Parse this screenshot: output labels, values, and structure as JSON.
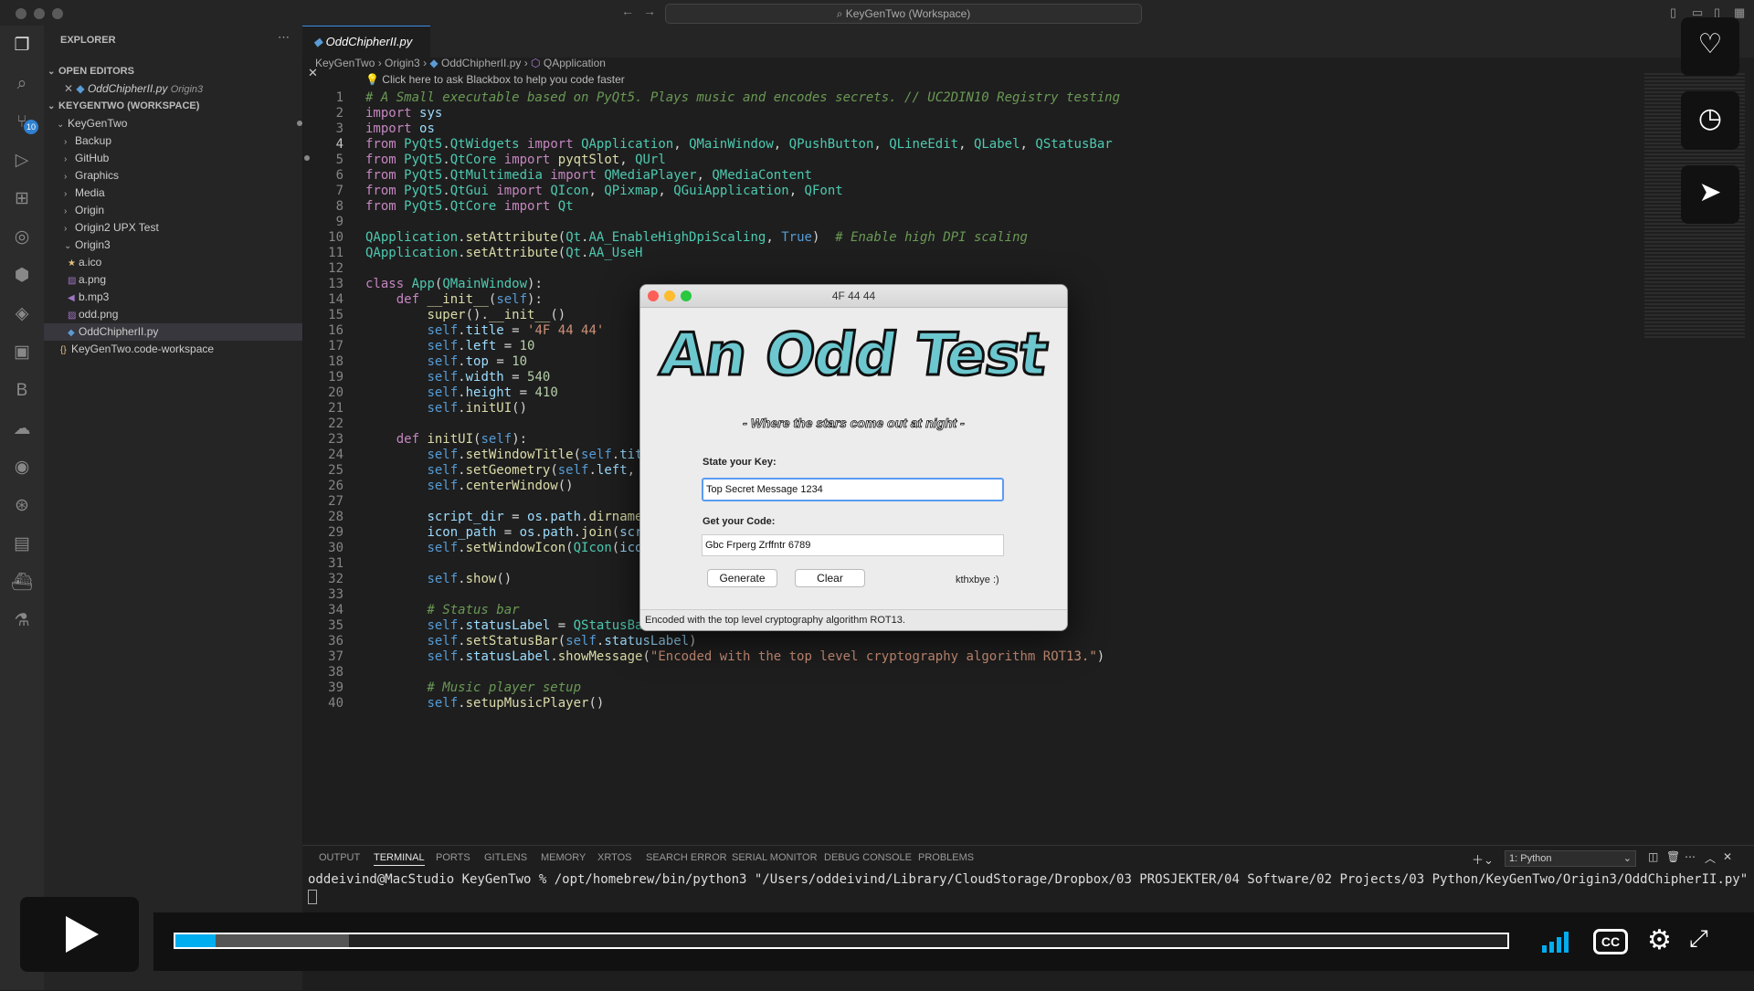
{
  "window": {
    "title": "KeyGenTwo (Workspace)"
  },
  "sidebar": {
    "title": "EXPLORER",
    "open_editors_header": "OPEN EDITORS",
    "open_editor": {
      "file": "OddChipherII.py",
      "folder": "Origin3"
    },
    "workspace_header": "KEYGENTWO (WORKSPACE)",
    "items": [
      {
        "label": "KeyGenTwo"
      },
      {
        "label": "Backup"
      },
      {
        "label": "GitHub"
      },
      {
        "label": "Graphics"
      },
      {
        "label": "Media"
      },
      {
        "label": "Origin"
      },
      {
        "label": "Origin2 UPX Test"
      },
      {
        "label": "Origin3"
      },
      {
        "label": "a.ico"
      },
      {
        "label": "a.png"
      },
      {
        "label": "b.mp3"
      },
      {
        "label": "odd.png"
      },
      {
        "label": "OddChipherII.py"
      },
      {
        "label": "KeyGenTwo.code-workspace"
      }
    ]
  },
  "activity": {
    "badge": "10"
  },
  "editor": {
    "tab": "OddChipherII.py",
    "breadcrumb": [
      "KeyGenTwo",
      "Origin3",
      "OddChipherII.py",
      "QApplication"
    ],
    "hint": "Click here to ask Blackbox to help you code faster",
    "line_numbers": [
      "1",
      "2",
      "3",
      "4",
      "5",
      "6",
      "7",
      "8",
      "9",
      "10",
      "11",
      "12",
      "13",
      "14",
      "15",
      "16",
      "17",
      "18",
      "19",
      "20",
      "21",
      "22",
      "23",
      "24",
      "25",
      "26",
      "27",
      "28",
      "29",
      "30",
      "31",
      "32",
      "33",
      "34",
      "35",
      "36",
      "37",
      "38",
      "39",
      "40"
    ],
    "lines": [
      "# A Small executable based on PyQt5. Plays music and encodes secrets. // UC2DIN10 Registry testing",
      "import sys",
      "import os",
      "from PyQt5.QtWidgets import QApplication, QMainWindow, QPushButton, QLineEdit, QLabel, QStatusBar",
      "from PyQt5.QtCore import pyqtSlot, QUrl",
      "from PyQt5.QtMultimedia import QMediaPlayer, QMediaContent",
      "from PyQt5.QtGui import QIcon, QPixmap, QGuiApplication, QFont",
      "from PyQt5.QtCore import Qt",
      "",
      "QApplication.setAttribute(Qt.AA_EnableHighDpiScaling, True)  # Enable high DPI scaling",
      "QApplication.setAttribute(Qt.AA_UseH",
      "",
      "class App(QMainWindow):",
      "    def __init__(self):",
      "        super().__init__()",
      "        self.title = '4F 44 44'",
      "        self.left = 10",
      "        self.top = 10",
      "        self.width = 540",
      "        self.height = 410",
      "        self.initUI()",
      "",
      "    def initUI(self):",
      "        self.setWindowTitle(self.tit",
      "        self.setGeometry(self.left,",
      "        self.centerWindow()",
      "",
      "        script_dir = os.path.dirname",
      "        icon_path = os.path.join(scr",
      "        self.setWindowIcon(QIcon(icon_path))",
      "",
      "        self.show()",
      "",
      "        # Status bar",
      "        self.statusLabel = QStatusBar()",
      "        self.setStatusBar(self.statusLabel)",
      "        self.statusLabel.showMessage(\"Encoded with the top level cryptography algorithm ROT13.\")",
      "",
      "        # Music player setup",
      "        self.setupMusicPlayer()"
    ]
  },
  "dialog": {
    "title": "4F 44 44",
    "logo_text": "An Odd Test",
    "tagline": "- Where the stars come out at night -",
    "key_label": "State your Key:",
    "key_value": "Top Secret Message 1234",
    "code_label": "Get your Code:",
    "code_value": "Gbc Frperg Zrffntr 6789",
    "generate_button": "Generate",
    "clear_button": "Clear",
    "sign_off": "kthxbye :)",
    "status": "Encoded with the top level cryptography algorithm ROT13."
  },
  "panel": {
    "tabs": [
      "OUTPUT",
      "TERMINAL",
      "PORTS",
      "GITLENS",
      "MEMORY",
      "XRTOS",
      "SEARCH ERROR",
      "SERIAL MONITOR",
      "DEBUG CONSOLE",
      "PROBLEMS"
    ],
    "active_tab": "TERMINAL",
    "terminal_select": "1: Python",
    "terminal_line": "oddeivind@MacStudio KeyGenTwo % /opt/homebrew/bin/python3 \"/Users/oddeivind/Library/CloudStorage/Dropbox/03 PROSJEKTER/04 Software/02 Projects/03 Python/KeyGenTwo/Origin3/OddChipherII.py\""
  },
  "video_player": {
    "progress": 0.03,
    "buffered": 0.13,
    "accent_color": "#00adef"
  },
  "colors": {
    "editor_bg": "#1e1e1e",
    "sidebar_bg": "#252526",
    "accent": "#3a8ee6",
    "logo": "#6cc7cf"
  }
}
